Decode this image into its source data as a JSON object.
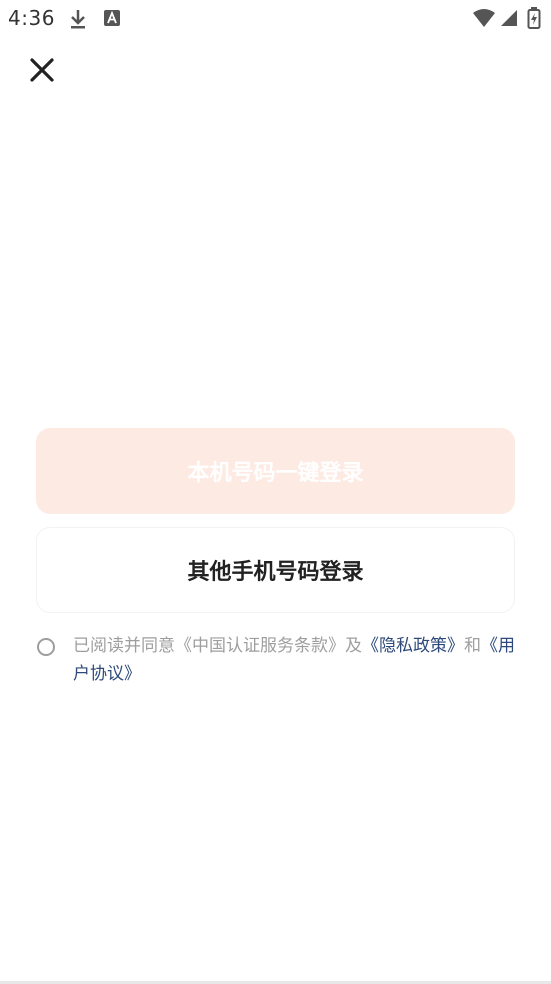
{
  "status_bar": {
    "time": "4:36",
    "icons": [
      "download-icon",
      "keyboard-a-icon",
      "wifi-icon",
      "cellular-signal-icon",
      "battery-charging-icon"
    ]
  },
  "header": {
    "close_icon": "close-icon"
  },
  "login": {
    "one_click_label": "本机号码一键登录",
    "other_phone_label": "其他手机号码登录"
  },
  "agreement": {
    "prefix": "已阅读并同意《中国认证服务条款》及",
    "privacy_link": "《隐私政策》",
    "and_text": "和",
    "user_link": "《用户协议》"
  },
  "colors": {
    "primary_button_bg": "#fdeae3",
    "link": "#2d4a7a",
    "muted_text": "#9e9e9e"
  }
}
